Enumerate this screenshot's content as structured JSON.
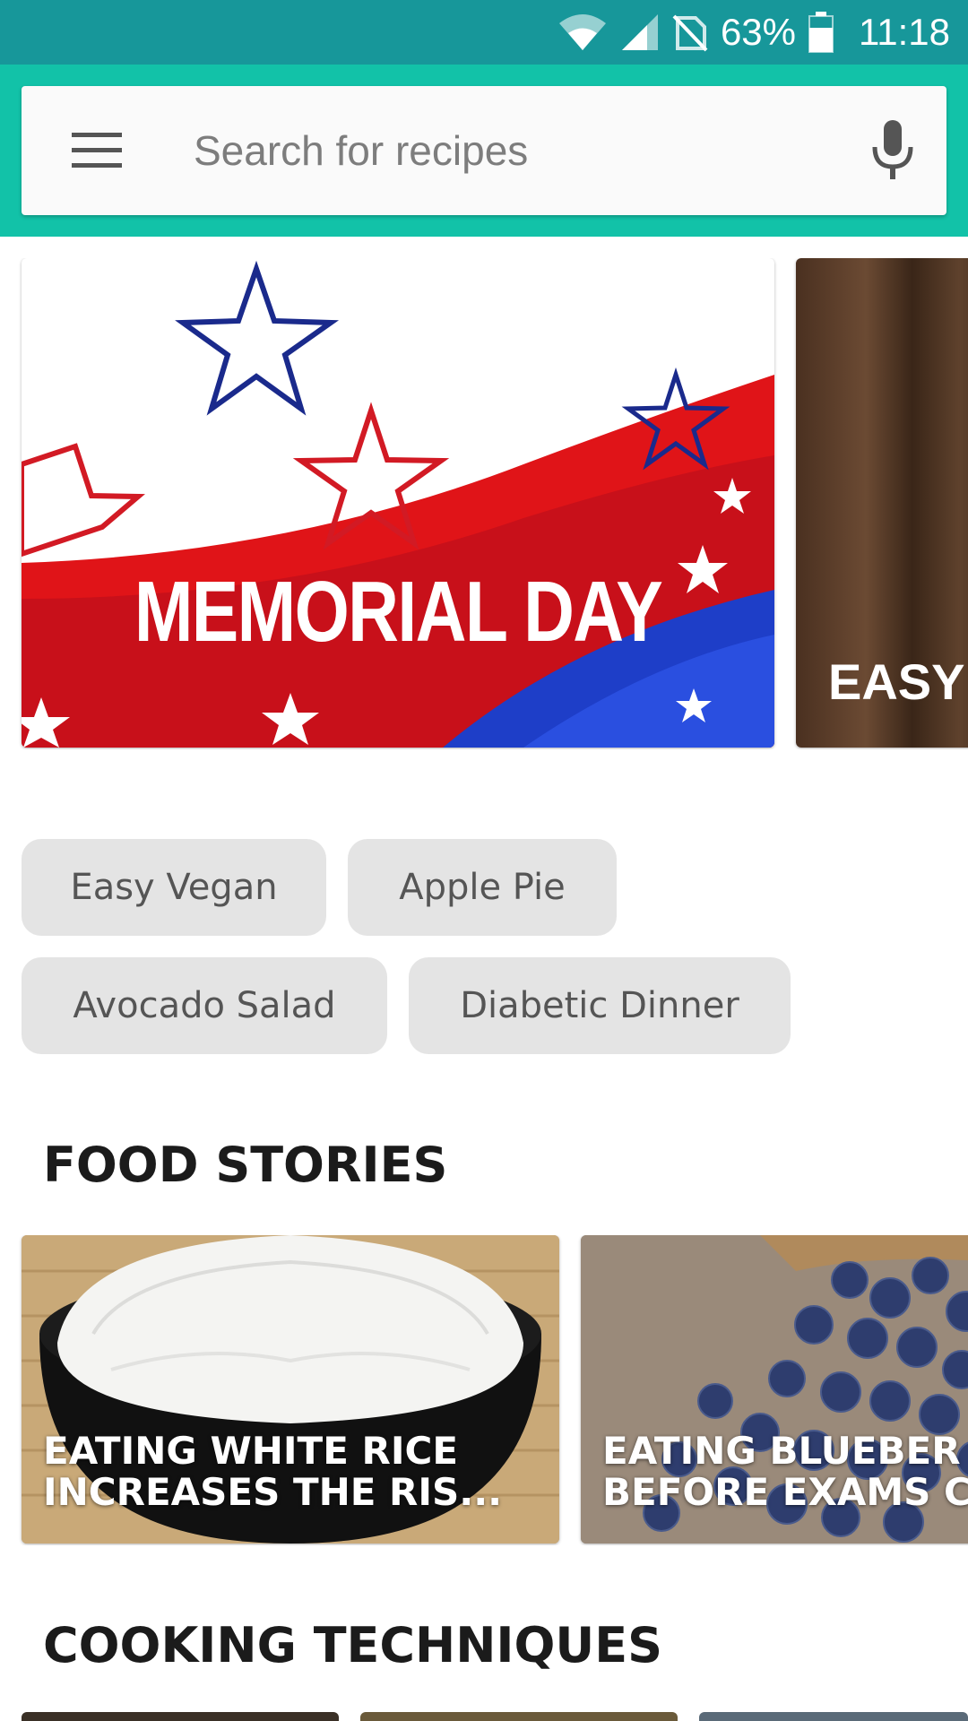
{
  "status_bar": {
    "battery": "63%",
    "time": "11:18",
    "icons": [
      "wifi-icon",
      "signal-icon",
      "no-sim-icon",
      "battery-icon"
    ]
  },
  "search": {
    "placeholder": "Search for recipes",
    "value": "",
    "icons": [
      "menu-icon",
      "mic-icon"
    ]
  },
  "featured": [
    {
      "label": "MEMORIAL DAY"
    },
    {
      "label": "EASY"
    }
  ],
  "chips": [
    "Easy Vegan",
    "Apple Pie",
    "Avocado Salad",
    "Diabetic Dinner"
  ],
  "food_stories": {
    "title": "FOOD STORIES",
    "items": [
      {
        "line1": "EATING WHITE RICE",
        "line2": "INCREASES THE RIS..."
      },
      {
        "line1": "EATING BLUEBER",
        "line2": "BEFORE EXAMS C"
      }
    ]
  },
  "cooking_techniques": {
    "title": "COOKING TECHNIQUES"
  },
  "colors": {
    "status_bar": "#17979a",
    "top_bar": "#12c2a8",
    "chip_bg": "#e4e4e4"
  }
}
